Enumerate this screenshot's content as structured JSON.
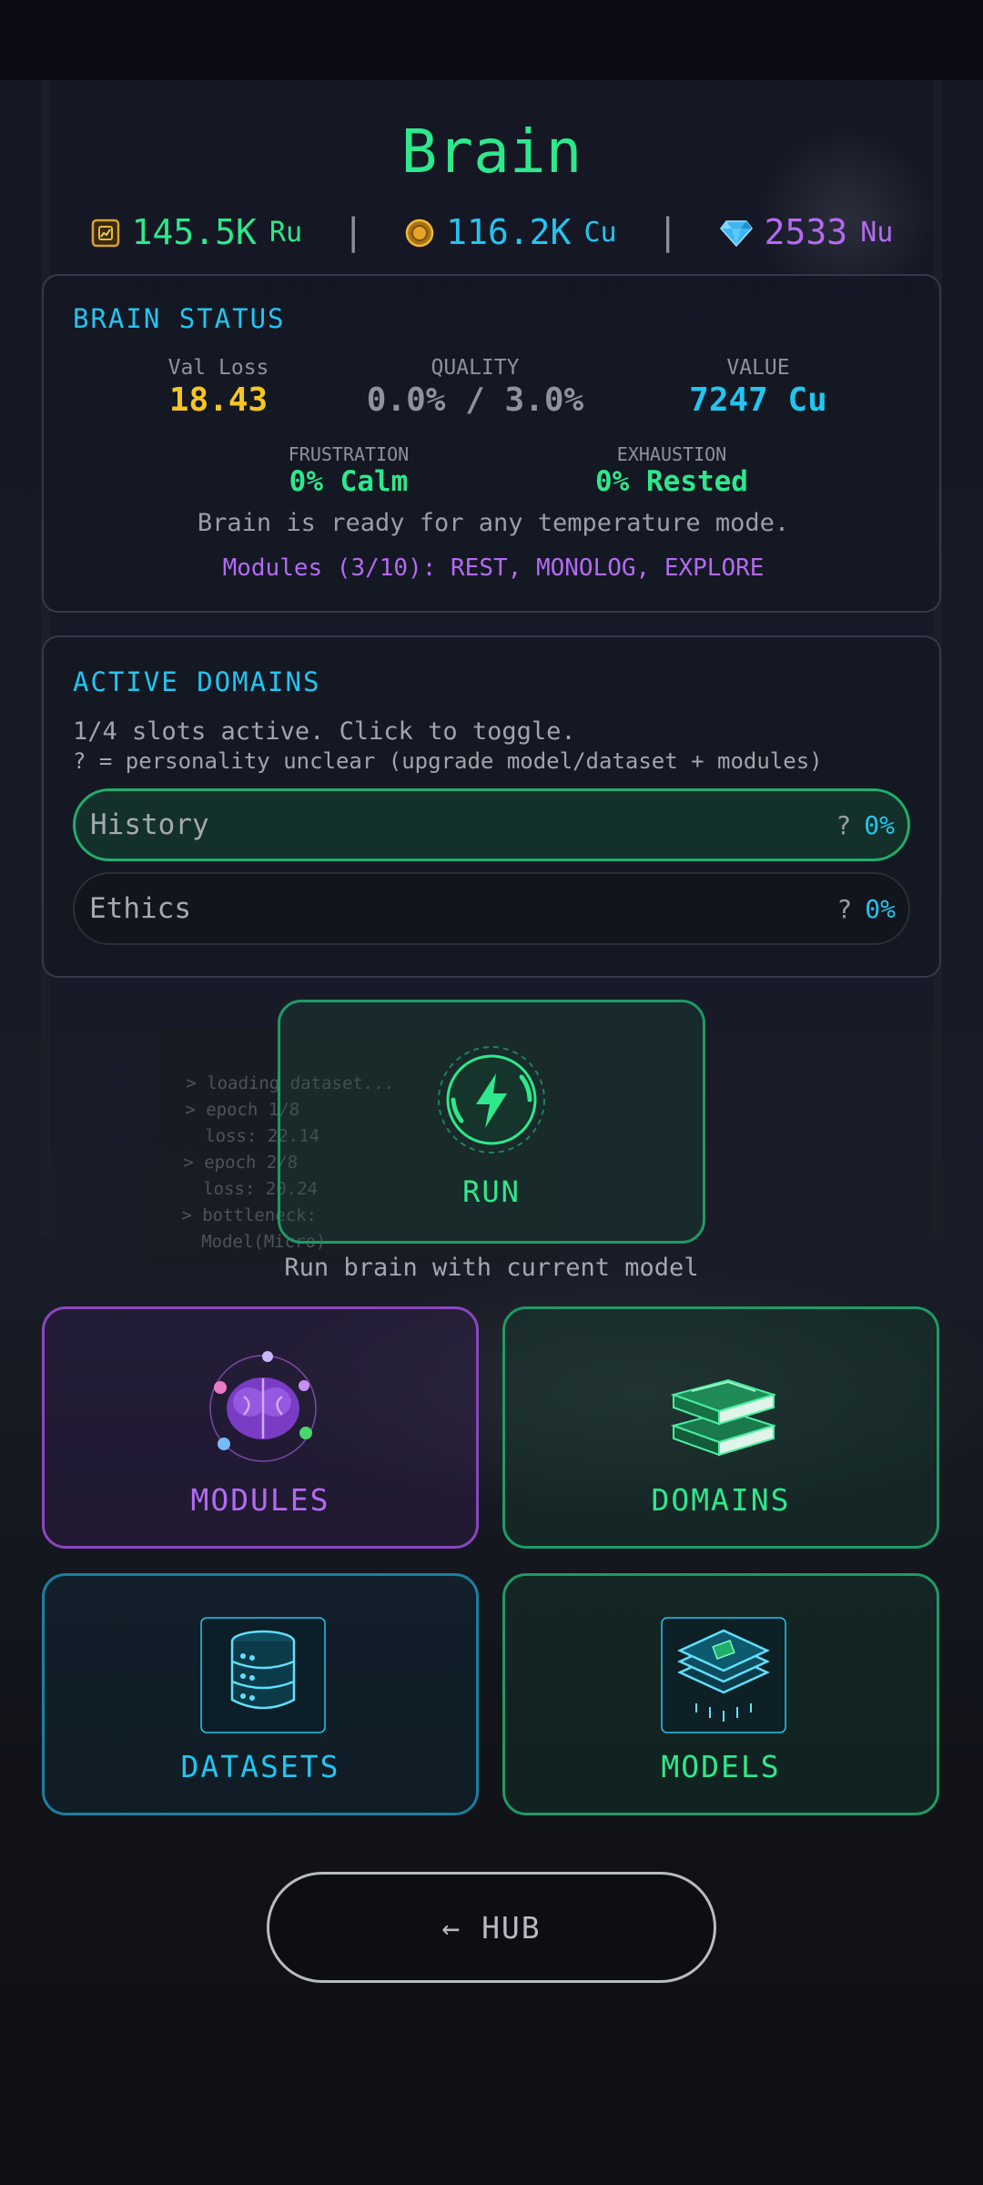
{
  "title": "Brain",
  "currencies": [
    {
      "amount": "145.5K",
      "unit": "Ru",
      "color": "#2ee88c",
      "icon": "chip-icon"
    },
    {
      "amount": "116.2K",
      "unit": "Cu",
      "color": "#22c5f0",
      "icon": "coin-icon"
    },
    {
      "amount": "2533",
      "unit": "Nu",
      "color": "#b46af2",
      "icon": "diamond-icon"
    }
  ],
  "separator": "|",
  "status": {
    "title": "BRAIN STATUS",
    "val_loss_label": "Val Loss",
    "val_loss_value": "18.43",
    "quality_label": "QUALITY",
    "quality_value": "0.0% / 3.0%",
    "value_label": "VALUE",
    "value_value": "7247 Cu",
    "frustration_label": "FRUSTRATION",
    "frustration_value": "0% Calm",
    "exhaustion_label": "EXHAUSTION",
    "exhaustion_value": "0% Rested",
    "message": "Brain is ready for any temperature mode.",
    "modules_line": "Modules (3/10): REST, MONOLOG, EXPLORE"
  },
  "domains": {
    "title": "ACTIVE DOMAINS",
    "slots_text": "1/4 slots active. Click to toggle.",
    "hint_text": "? = personality unclear (upgrade model/dataset + modules)",
    "items": [
      {
        "name": "History",
        "q": "?",
        "pct": "0%",
        "active": true
      },
      {
        "name": "Ethics",
        "q": "?",
        "pct": "0%",
        "active": false
      }
    ]
  },
  "laptop_terminal": [
    "> loading dataset...",
    "> epoch 1/8",
    "  loss: 22.14",
    "> epoch 2/8",
    "  loss: 20.24",
    "> bottleneck:",
    "  Model(Micro)"
  ],
  "run": {
    "label": "RUN",
    "caption": "Run brain with current model"
  },
  "tiles": {
    "modules": "MODULES",
    "domains": "DOMAINS",
    "datasets": "DATASETS",
    "models": "MODELS"
  },
  "hub_label": "← HUB",
  "colors": {
    "green": "#2ee88c",
    "cyan": "#22c5f0",
    "purple": "#b46af2",
    "yellow": "#f5c623",
    "gray": "#8d929c"
  }
}
